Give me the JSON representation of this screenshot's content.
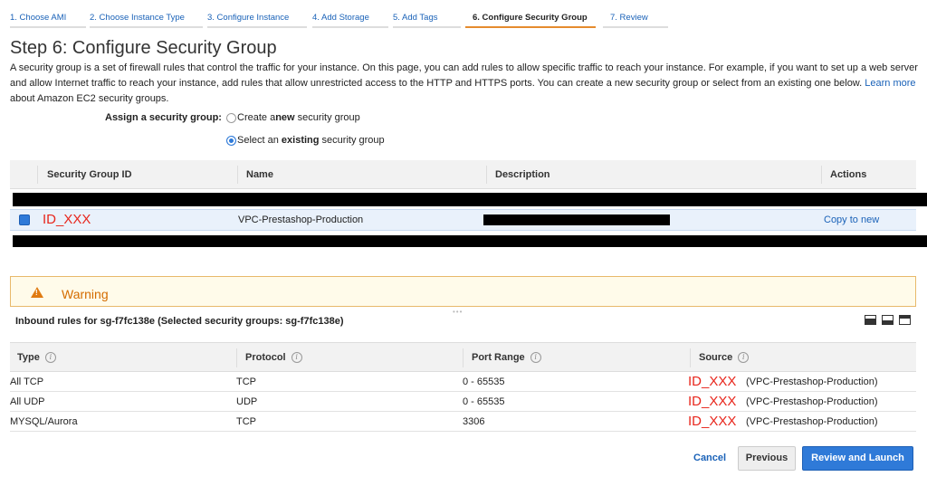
{
  "wizard": {
    "steps": [
      "1. Choose AMI",
      "2. Choose Instance Type",
      "3. Configure Instance",
      "4. Add Storage",
      "5. Add Tags",
      "6. Configure Security Group",
      "7. Review"
    ],
    "active_index": 5
  },
  "page": {
    "title": "Step 6: Configure Security Group",
    "intro_text": "A security group is a set of firewall rules that control the traffic for your instance. On this page, you can add rules to allow specific traffic to reach your instance. For example, if you want to set up a web server and allow Internet traffic to reach your instance, add rules that allow unrestricted access to the HTTP and HTTPS ports. You can create a new security group or select from an existing one below.",
    "learn_more": "Learn more",
    "learn_more_suffix": "about Amazon EC2 security groups."
  },
  "assign": {
    "label": "Assign a security group:",
    "option_create": {
      "pre": "Create a ",
      "bold": "new",
      "post": " security group",
      "selected": false
    },
    "option_select": {
      "pre": "Select an ",
      "bold": "existing",
      "post": " security group",
      "selected": true
    }
  },
  "sg_table": {
    "headers": [
      "Security Group ID",
      "Name",
      "Description",
      "Actions"
    ],
    "selected_row": {
      "id": "ID_XXX",
      "name": "VPC-Prestashop-Production",
      "action": "Copy to new"
    }
  },
  "warning": {
    "title": "Warning"
  },
  "inbound": {
    "title": "Inbound rules for sg-f7fc138e (Selected security groups: sg-f7fc138e)",
    "headers": [
      "Type",
      "Protocol",
      "Port Range",
      "Source"
    ],
    "info_glyph": "i",
    "rows": [
      {
        "type": "All TCP",
        "protocol": "TCP",
        "port": "0 - 65535",
        "source_id": "ID_XXX",
        "source_name": "(VPC-Prestashop-Production)"
      },
      {
        "type": "All UDP",
        "protocol": "UDP",
        "port": "0 - 65535",
        "source_id": "ID_XXX",
        "source_name": "(VPC-Prestashop-Production)"
      },
      {
        "type": "MYSQL/Aurora",
        "protocol": "TCP",
        "port": "3306",
        "source_id": "ID_XXX",
        "source_name": "(VPC-Prestashop-Production)"
      }
    ]
  },
  "buttons": {
    "cancel": "Cancel",
    "previous": "Previous",
    "review_launch": "Review and Launch"
  },
  "colors": {
    "accent_blue": "#2f7ad8",
    "link_blue": "#1a62b8",
    "warning_orange": "#e07b12",
    "redaction_red": "#e8261c"
  }
}
